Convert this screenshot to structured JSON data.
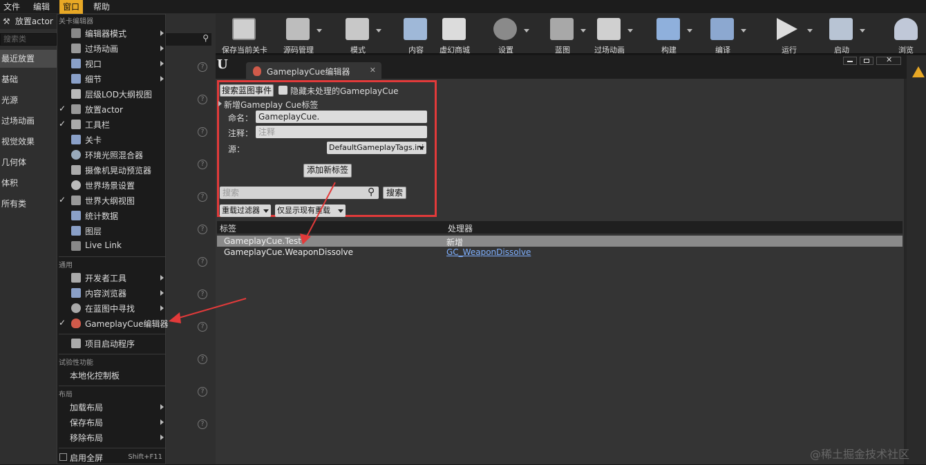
{
  "menubar": {
    "file": "文件",
    "edit": "编辑",
    "window": "窗口",
    "help": "帮助"
  },
  "toolbar": {
    "items": [
      {
        "label": "保存当前关卡",
        "icon": "save-icon"
      },
      {
        "label": "源码管理",
        "icon": "source-control-icon"
      },
      {
        "label": "模式",
        "icon": "modes-icon"
      },
      {
        "label": "内容",
        "icon": "content-icon"
      },
      {
        "label": "虚幻商城",
        "icon": "marketplace-icon"
      },
      {
        "label": "设置",
        "icon": "settings-icon"
      },
      {
        "label": "蓝图",
        "icon": "blueprint-icon"
      },
      {
        "label": "过场动画",
        "icon": "cinematics-icon"
      },
      {
        "label": "构建",
        "icon": "build-icon"
      },
      {
        "label": "编译",
        "icon": "compile-icon"
      },
      {
        "label": "运行",
        "icon": "play-icon"
      },
      {
        "label": "启动",
        "icon": "launch-icon"
      },
      {
        "label": "浏览",
        "icon": "browse-icon"
      }
    ]
  },
  "leftpanel": {
    "title": "放置actor",
    "search_placeholder": "搜索类",
    "categories": [
      "最近放置",
      "基础",
      "光源",
      "过场动画",
      "视觉效果",
      "几何体",
      "体积",
      "所有类"
    ]
  },
  "menu": {
    "section1": "关卡编辑器",
    "items1": [
      {
        "label": "编辑器模式",
        "checked": "",
        "submenu": true
      },
      {
        "label": "过场动画",
        "checked": "",
        "submenu": true
      },
      {
        "label": "视口",
        "checked": "",
        "submenu": true
      },
      {
        "label": "细节",
        "checked": "",
        "submenu": true
      },
      {
        "label": "层级LOD大纲视图",
        "checked": "",
        "submenu": false
      },
      {
        "label": "放置actor",
        "checked": "✓",
        "submenu": false
      },
      {
        "label": "工具栏",
        "checked": "✓",
        "submenu": false
      },
      {
        "label": "关卡",
        "checked": "",
        "submenu": false
      },
      {
        "label": "环境光照混合器",
        "checked": "",
        "submenu": false
      },
      {
        "label": "摄像机晃动预览器",
        "checked": "",
        "submenu": false
      },
      {
        "label": "世界场景设置",
        "checked": "",
        "submenu": false
      },
      {
        "label": "世界大纲视图",
        "checked": "✓",
        "submenu": false
      },
      {
        "label": "统计数据",
        "checked": "",
        "submenu": false
      },
      {
        "label": "图层",
        "checked": "",
        "submenu": false
      },
      {
        "label": "Live Link",
        "checked": "",
        "submenu": false
      }
    ],
    "section2": "通用",
    "items2": [
      {
        "label": "开发者工具",
        "checked": "",
        "submenu": true
      },
      {
        "label": "内容浏览器",
        "checked": "",
        "submenu": true
      },
      {
        "label": "在蓝图中寻找",
        "checked": "",
        "submenu": true
      },
      {
        "label": "GameplayCue编辑器",
        "checked": "✓",
        "submenu": false
      }
    ],
    "project_launcher": "项目启动程序",
    "section3": "试验性功能",
    "localization": "本地化控制板",
    "section4": "布局",
    "items4": [
      {
        "label": "加载布局",
        "submenu": true
      },
      {
        "label": "保存布局",
        "submenu": true
      },
      {
        "label": "移除布局",
        "submenu": true
      }
    ],
    "fullscreen": "启用全屏",
    "fullscreen_shortcut": "Shift+F11"
  },
  "editor": {
    "tab_title": "GameplayCue编辑器",
    "search_bp_events": "搜索蓝图事件",
    "hide_unhandled": "隐藏未处理的GameplayCue",
    "new_tag_header": "新增Gameplay Cue标签",
    "name_label": "命名：",
    "name_value": "GameplayCue.",
    "comment_label": "注释：",
    "comment_placeholder": "注释",
    "source_label": "源：",
    "source_value": "DefaultGameplayTags.ini",
    "add_tag_button": "添加新标签",
    "search_placeholder": "搜索",
    "search_button": "搜索",
    "override_filter": "重载过滤器",
    "only_show_overrides": "仅显示现有重载",
    "columns": {
      "tag": "标签",
      "handler": "处理器"
    },
    "rows": [
      {
        "tag": "GameplayCue.Test",
        "handler": "新增",
        "link": false
      },
      {
        "tag": "GameplayCue.WeaponDissolve",
        "handler": "GC_WeaponDissolve",
        "link": true
      }
    ]
  },
  "watermark": "@稀土掘金技术社区",
  "colors": {
    "accent": "#e8a825",
    "highlight_box": "#e23a3a",
    "link": "#7fb0ff"
  }
}
